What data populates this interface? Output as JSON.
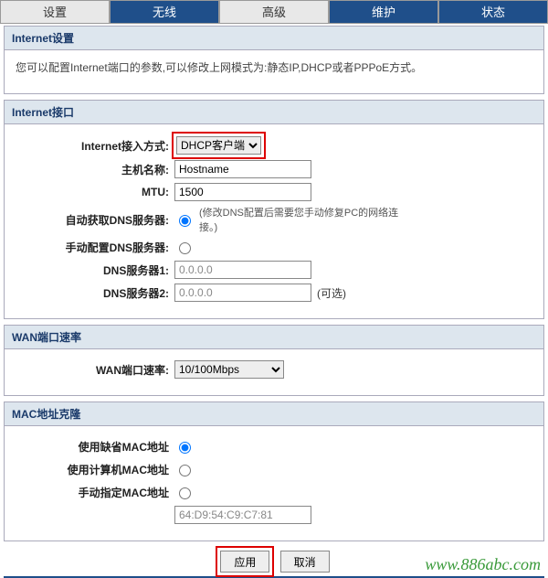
{
  "tabs": {
    "settings": "设置",
    "wireless": "无线",
    "advanced": "高级",
    "maintenance": "维护",
    "status": "状态"
  },
  "internet_settings": {
    "title": "Internet设置",
    "desc": "您可以配置Internet端口的参数,可以修改上网模式为:静态IP,DHCP或者PPPoE方式。"
  },
  "internet_interface": {
    "title": "Internet接口",
    "access": {
      "label": "Internet接入方式:",
      "value": "DHCP客户端"
    },
    "hostname": {
      "label": "主机名称:",
      "value": "Hostname"
    },
    "mtu": {
      "label": "MTU:",
      "value": "1500"
    },
    "auto_dns": {
      "label": "自动获取DNS服务器:",
      "note": "(修改DNS配置后需要您手动修复PC的网络连接。)"
    },
    "manual_dns": {
      "label": "手动配置DNS服务器:"
    },
    "dns1": {
      "label": "DNS服务器1:",
      "value": "0.0.0.0"
    },
    "dns2": {
      "label": "DNS服务器2:",
      "value": "0.0.0.0",
      "optional": "(可选)"
    }
  },
  "wan_rate": {
    "title": "WAN端口速率",
    "label": "WAN端口速率:",
    "value": "10/100Mbps"
  },
  "mac_clone": {
    "title": "MAC地址克隆",
    "default_mac": {
      "label": "使用缺省MAC地址"
    },
    "pc_mac": {
      "label": "使用计算机MAC地址"
    },
    "manual_mac": {
      "label": "手动指定MAC地址"
    },
    "mac_value": "64:D9:54:C9:C7:81"
  },
  "buttons": {
    "apply": "应用",
    "cancel": "取消"
  },
  "watermark": "www.886abc.com"
}
